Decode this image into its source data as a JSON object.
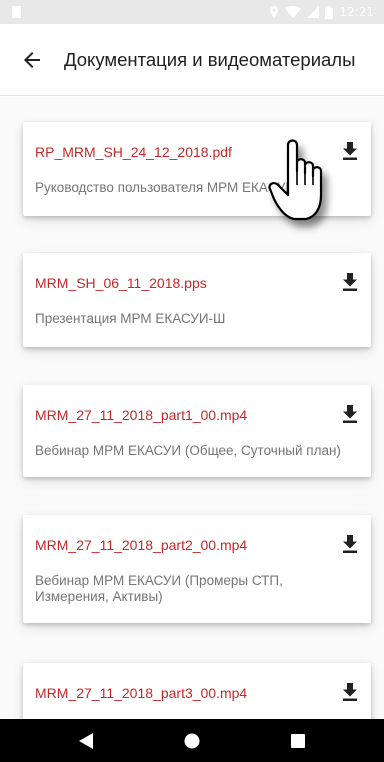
{
  "status_bar": {
    "time": "12:21"
  },
  "app_bar": {
    "title": "Документация и видеоматериалы"
  },
  "documents": [
    {
      "file_name": "RP_MRM_SH_24_12_2018.pdf",
      "description": "Руководство пользователя МРМ ЕКАСУИ-Ш"
    },
    {
      "file_name": "MRM_SH_06_11_2018.pps",
      "description": "Презентация МРМ ЕКАСУИ-Ш"
    },
    {
      "file_name": "MRM_27_11_2018_part1_00.mp4",
      "description": "Вебинар МРМ ЕКАСУИ (Общее, Суточный план)"
    },
    {
      "file_name": "MRM_27_11_2018_part2_00.mp4",
      "description": "Вебинар МРМ ЕКАСУИ (Промеры СТП, Измерения, Активы)"
    },
    {
      "file_name": "MRM_27_11_2018_part3_00.mp4",
      "description": ""
    }
  ],
  "icons": {
    "back": "arrow-left-icon",
    "download": "download-icon",
    "pointer": "hand-pointer-icon",
    "nav_back": "triangle-back-icon",
    "nav_home": "circle-home-icon",
    "nav_recent": "square-recent-icon"
  },
  "colors": {
    "accent": "#c62828",
    "text_primary": "#212121",
    "text_secondary": "#757575",
    "status_bar": "#e8e8e8",
    "nav_bar": "#000000"
  }
}
